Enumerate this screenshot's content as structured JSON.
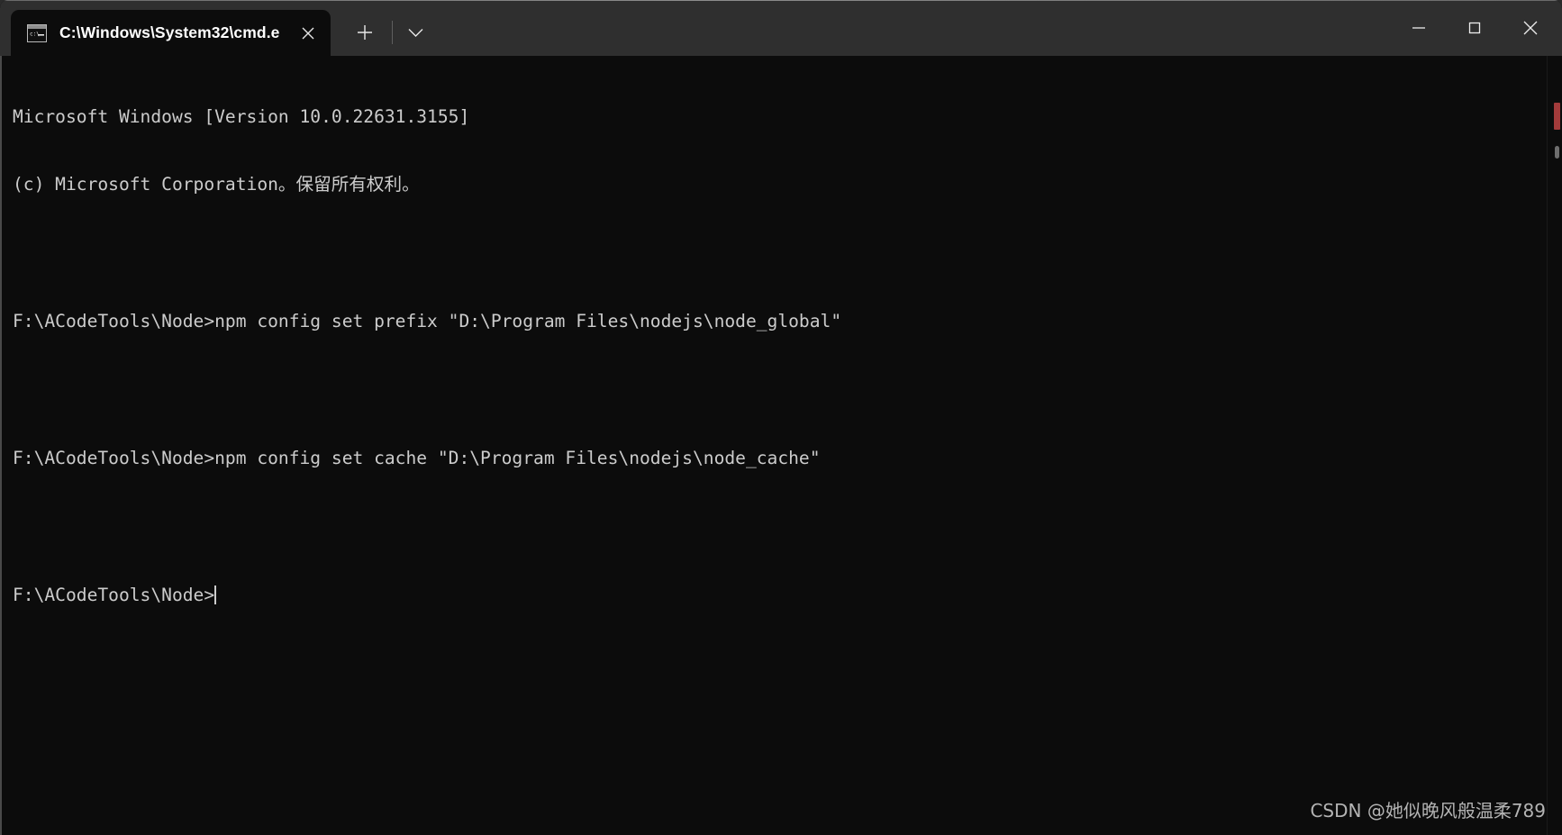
{
  "window": {
    "title": "C:\\Windows\\System32\\cmd.e",
    "background_color": "#0c0c0c",
    "titlebar_color": "#2f2f2f"
  },
  "tabbar": {
    "tabs": [
      {
        "icon": "cmd-console-icon",
        "label": "C:\\Windows\\System32\\cmd.e",
        "close_label": "✕",
        "active": true
      }
    ],
    "new_tab_label": "＋",
    "dropdown_label": "⌄"
  },
  "window_controls": {
    "minimize_label": "—",
    "maximize_label": "☐",
    "close_label": "✕"
  },
  "terminal": {
    "foreground_color": "#cccccc",
    "lines": [
      "Microsoft Windows [Version 10.0.22631.3155]",
      "(c) Microsoft Corporation。保留所有权利。",
      "",
      "F:\\ACodeTools\\Node>npm config set prefix \"D:\\Program Files\\nodejs\\node_global\"",
      "",
      "F:\\ACodeTools\\Node>npm config set cache \"D:\\Program Files\\nodejs\\node_cache\"",
      "",
      "F:\\ACodeTools\\Node>"
    ],
    "prompt": "F:\\ACodeTools\\Node>",
    "cursor_visible": true
  },
  "watermark": {
    "text": "CSDN @她似晚风般温柔789"
  }
}
